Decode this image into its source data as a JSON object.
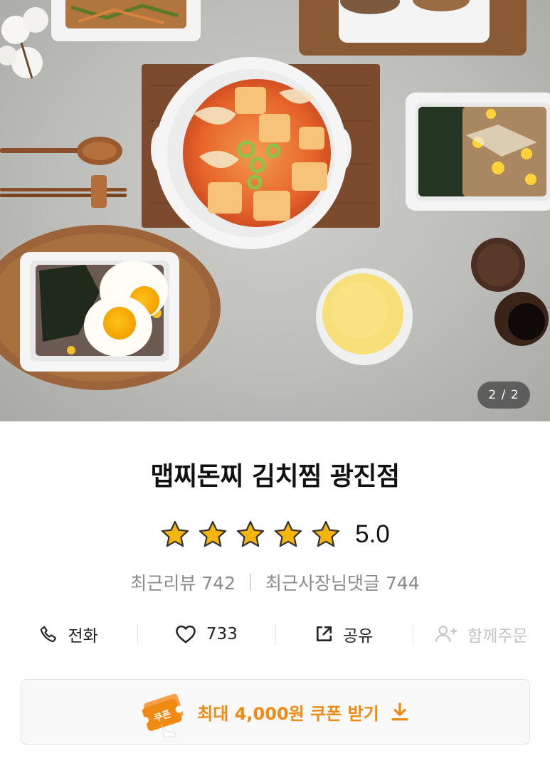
{
  "gallery": {
    "page_indicator": "2 / 2"
  },
  "store": {
    "name": "맵찌돈찌 김치찜 광진점",
    "rating": {
      "stars_filled": 5,
      "stars_total": 5,
      "value": "5.0",
      "star_color": "#f6b40e"
    },
    "recent_reviews_label": "최근리뷰 742",
    "recent_owner_replies_label": "최근사장님댓글 744"
  },
  "actions": {
    "call_label": "전화",
    "like_count": "733",
    "share_label": "공유",
    "group_order_label": "함께주문"
  },
  "coupon": {
    "label": "최대 4,000원 쿠폰 받기",
    "icon_text": "쿠폰",
    "accent_color": "#f08a13"
  },
  "icons": {
    "call": "phone-icon",
    "like": "heart-icon",
    "share": "share-icon",
    "group_order": "add-user-icon",
    "coupon": "coupon-ticket-icon",
    "download": "download-arrow-icon"
  }
}
